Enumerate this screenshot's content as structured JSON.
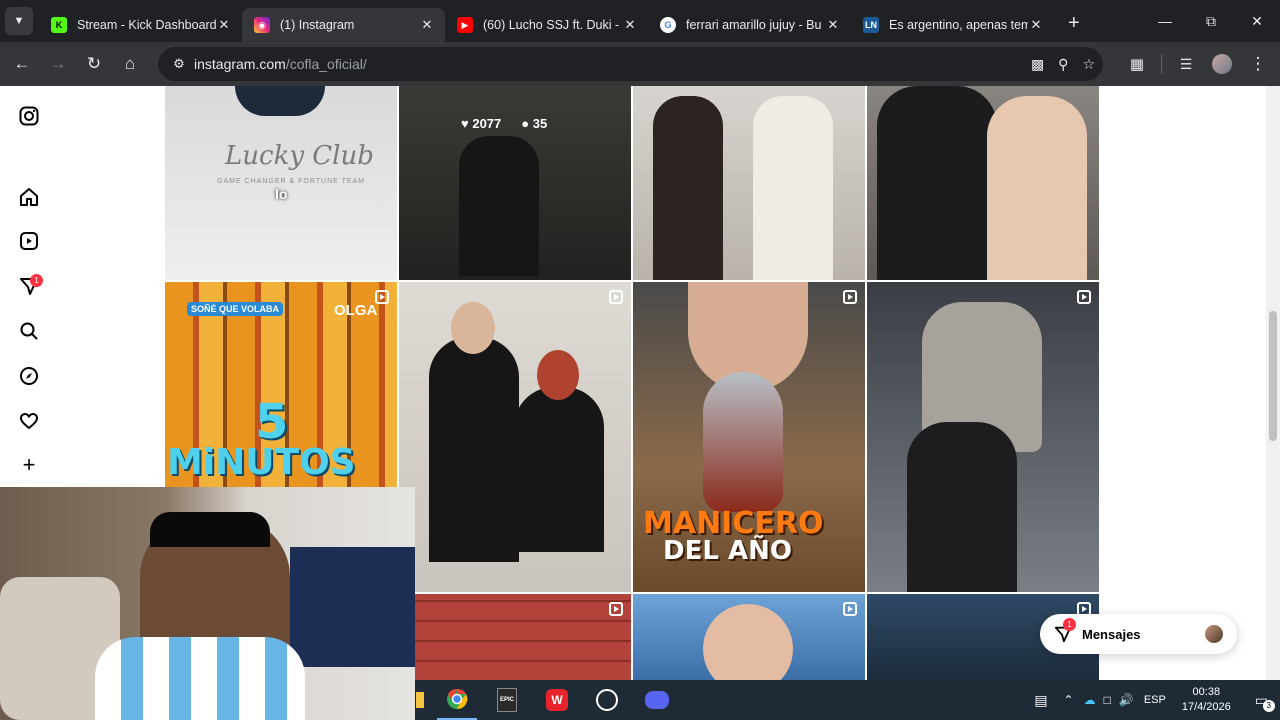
{
  "browser": {
    "tabs": [
      {
        "title": "Stream - Kick Dashboard",
        "favicon": "kick-icon",
        "active": false
      },
      {
        "title": "(1) Instagram",
        "favicon": "instagram-icon",
        "active": true
      },
      {
        "title": "(60) Lucho SSJ ft. Duki - I",
        "favicon": "youtube-icon",
        "active": false
      },
      {
        "title": "ferrari amarillo jujuy - Bu",
        "favicon": "google-icon",
        "active": false
      },
      {
        "title": "Es argentino, apenas tem",
        "favicon": "ln-icon",
        "active": false
      }
    ],
    "url_host": "instagram.com",
    "url_path": "/cofla_oficial/"
  },
  "sidebar": {
    "notification_count": "1"
  },
  "grid": {
    "post_likes": "2077",
    "post_comments": "35",
    "tile_lucky_text": "Lucky Club",
    "tile_lucky_sub": "GAME CHANGER & FORTUNE TEAM",
    "tile_lucky_caption": "lo",
    "tile_olga_top": "SOÑÉ QUE VOLABA",
    "tile_olga_brand": "OLGA",
    "tile_olga_big1": "5",
    "tile_olga_big2": "MiNUTOS",
    "tile_manicero_line1": "MANICERO",
    "tile_manicero_line2": "DEL AÑO"
  },
  "messages": {
    "label": "Mensajes",
    "badge": "1"
  },
  "taskbar": {
    "lang": "ESP",
    "time": "00:38",
    "date": "17/4/2026",
    "notif": "3"
  },
  "colors": {
    "instagram_red": "#ff3040",
    "chrome_dark": "#202124",
    "toolbar": "#35363a"
  }
}
